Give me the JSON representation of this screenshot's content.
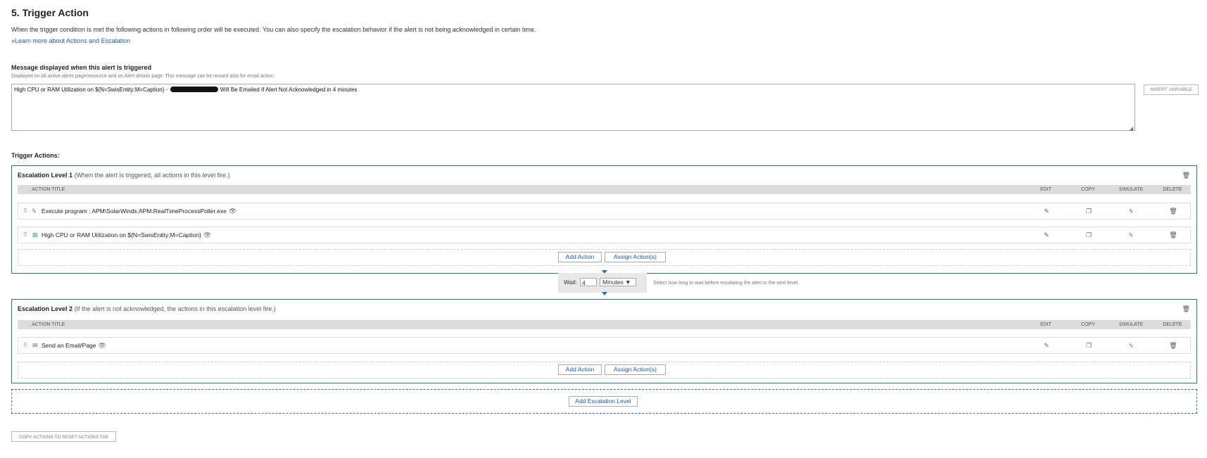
{
  "section": {
    "title": "5. Trigger Action",
    "description": "When the trigger condition is met the following actions in following order will be executed. You can also specify the escalation behavior if the alert is not being acknowledged in certain time.",
    "learn_more": "»Learn more about Actions and Escalation"
  },
  "message": {
    "label": "Message displayed when this alert is triggered",
    "sublabel": "Displayed on All active alerts page/resource and on Alert details page. This message can be reused also for email action.",
    "text_before": "High CPU or RAM Utilization on ${N=SwisEntity;M=Caption} - ",
    "text_after": " Will Be Emailed If Alert Not Acknowledged in 4 minutes",
    "insert_variable": "INSERT VARIABLE"
  },
  "trigger_actions_label": "Trigger Actions:",
  "table_headers": {
    "action_title": "ACTION TITLE",
    "edit": "EDIT",
    "copy": "COPY",
    "simulate": "SIMULATE",
    "delete": "DELETE"
  },
  "levels": [
    {
      "name": "Escalation Level 1",
      "subtitle": "(When the alert is triggered, all actions in this level fire.)",
      "actions": [
        {
          "icon": "bolt-icon",
          "title": "Execute program : APM\\SolarWinds.APM.RealTimeProcessPoller.exe"
        },
        {
          "icon": "message-icon",
          "title": "High CPU or RAM Utilization on ${N=SwisEntity;M=Caption}"
        }
      ]
    },
    {
      "name": "Escalation Level 2",
      "subtitle": "(If the alert is not acknowledged, the actions in this escalation level fire.)",
      "actions": [
        {
          "icon": "envelope-icon",
          "title": "Send an Email/Page"
        }
      ]
    }
  ],
  "buttons": {
    "add_action": "Add Action",
    "assign_actions": "Assign Action(s)",
    "add_escalation_level": "Add Escalation Level",
    "copy_actions": "COPY ACTIONS TO RESET ACTIONS TAB"
  },
  "wait": {
    "label": "Wait:",
    "value": "4",
    "unit": "Minutes ▼",
    "hint": "Select how long to wait before escalating the alert to the next level."
  },
  "colors": {
    "accent": "#2d6f96",
    "link": "#1a5aa0",
    "header_bg": "#dcdcdc"
  }
}
